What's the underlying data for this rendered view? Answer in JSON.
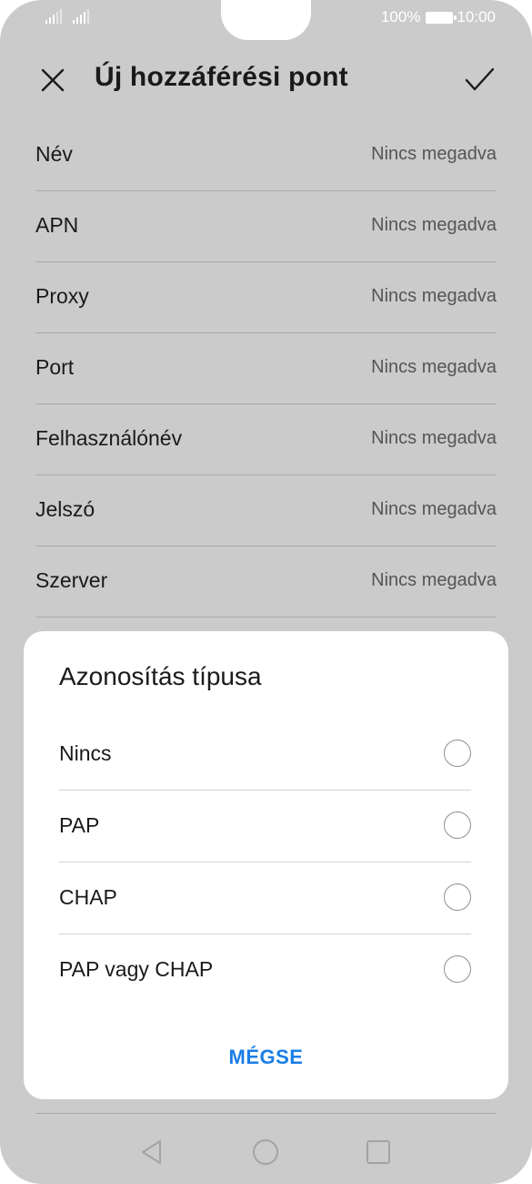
{
  "status_bar": {
    "battery_percent": "100%",
    "time": "10:00"
  },
  "appbar": {
    "title": "Új hozzáférési pont",
    "close_icon": "close-icon",
    "confirm_icon": "check-icon"
  },
  "fields": [
    {
      "label": "Név",
      "value": "Nincs megadva"
    },
    {
      "label": "APN",
      "value": "Nincs megadva"
    },
    {
      "label": "Proxy",
      "value": "Nincs megadva"
    },
    {
      "label": "Port",
      "value": "Nincs megadva"
    },
    {
      "label": "Felhasználónév",
      "value": "Nincs megadva"
    },
    {
      "label": "Jelszó",
      "value": "Nincs megadva"
    },
    {
      "label": "Szerver",
      "value": "Nincs megadva"
    }
  ],
  "dialog": {
    "title": "Azonosítás típusa",
    "options": [
      {
        "label": "Nincs",
        "selected": false
      },
      {
        "label": "PAP",
        "selected": false
      },
      {
        "label": "CHAP",
        "selected": false
      },
      {
        "label": "PAP vagy CHAP",
        "selected": false
      }
    ],
    "cancel_label": "MÉGSE"
  },
  "navbar": {
    "back_icon": "back-triangle-icon",
    "home_icon": "home-circle-icon",
    "recents_icon": "recents-square-icon"
  },
  "colors": {
    "accent": "#1a7ee6",
    "scrim_background": "#cbcbcb"
  }
}
